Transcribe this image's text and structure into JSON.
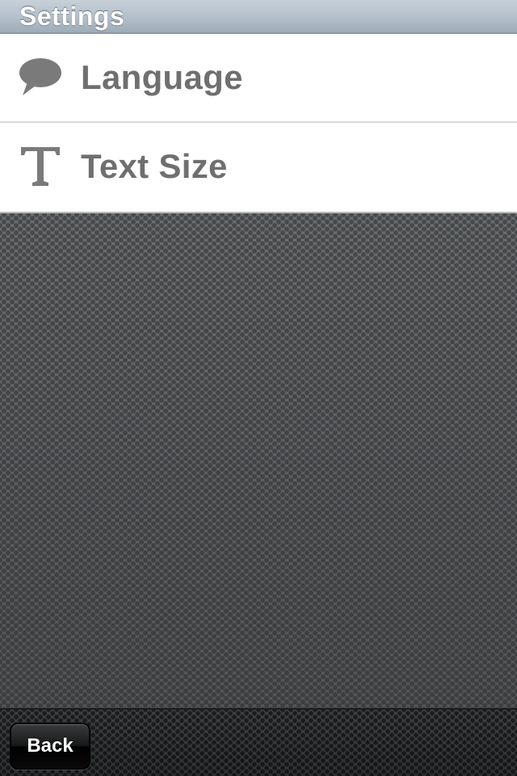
{
  "header": {
    "title": "Settings"
  },
  "list": {
    "items": [
      {
        "label": "Language",
        "icon": "speech-bubble-icon"
      },
      {
        "label": "Text Size",
        "icon": "text-size-icon"
      }
    ]
  },
  "toolbar": {
    "back_label": "Back"
  },
  "colors": {
    "header_bg": "#b3bfca",
    "row_bg": "#ffffff",
    "row_text": "#6f6f6f",
    "icon": "#7a7a7a",
    "background": "#5b5d5f",
    "toolbar_bg": "#2b2c2e"
  }
}
